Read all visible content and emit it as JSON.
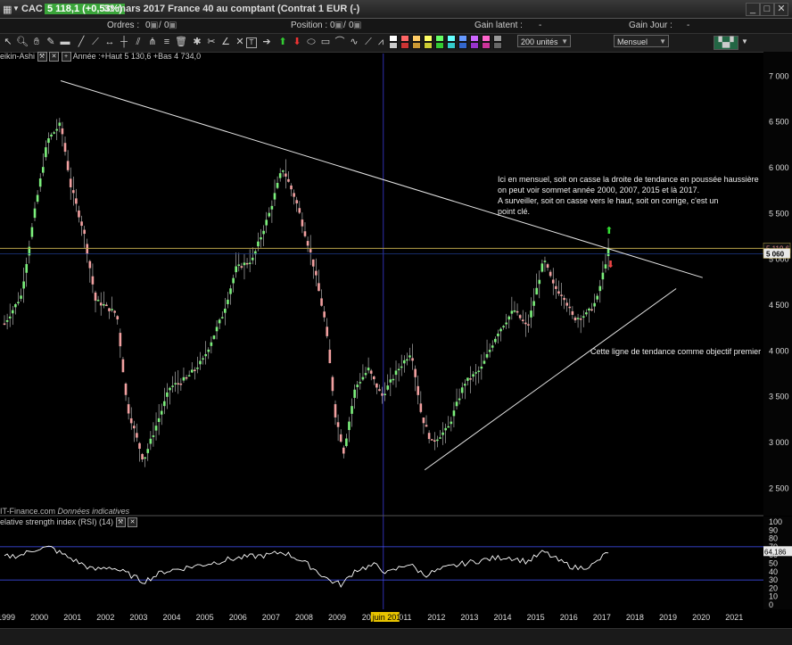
{
  "window": {
    "symbol": "CAC",
    "price_change": "5 118,1 (+0,53%)",
    "description": "31 mars 2017 France 40 au comptant (Contrat 1 EUR (-)"
  },
  "info": {
    "orders_label": "Ordres :",
    "orders_value": "0",
    "orders_value2": "0",
    "position_label": "Position :",
    "position_value": "0",
    "position_value2": "0",
    "gain_latent_label": "Gain latent :",
    "gain_latent_value": "-",
    "gain_jour_label": "Gain Jour :",
    "gain_jour_value": "-"
  },
  "toolbar": {
    "units_select": "200 unités",
    "period_select": "Mensuel"
  },
  "colors": {
    "up_candle": "#7cf07c",
    "down_candle": "#f2a0a0",
    "trend_line": "#e6e6e6",
    "level_line": "#b8a24a",
    "crosshair": "#3a3ad6",
    "rsi_band": "#4455ff",
    "rsi_line": "#ffffff"
  },
  "legend": {
    "name": "eikin-Ashi",
    "values": "Année :+Haut 5 130,6 +Bas 4 734,0"
  },
  "source": {
    "provider": "IT-Finance.com",
    "note": "Données indicatives"
  },
  "rsi_legend": "elative strength index (RSI) (14)",
  "annotations": {
    "top_text": [
      "Ici en mensuel, soit on casse la droite de tendance en poussée haussière",
      "on peut voir sommet année 2000, 2007, 2015 et là 2017.",
      "A surveiller, soit on casse vers le haut, soit on corrige, c'est un",
      "point clé."
    ],
    "bottom_text": "Cette ligne de tendance comme objectif premier"
  },
  "chart_data": {
    "type": "candlestick",
    "variant": "heikin-ashi",
    "timeframe": "monthly",
    "x_axis": {
      "type": "date",
      "tick_labels": [
        "1999",
        "2000",
        "2001",
        "2002",
        "2003",
        "2004",
        "2005",
        "2006",
        "2007",
        "2008",
        "2009",
        "20",
        "juin 2010",
        "2011",
        "2012",
        "2013",
        "2014",
        "2015",
        "2016",
        "2017",
        "2018",
        "2019",
        "2020",
        "2021"
      ],
      "range": [
        1999,
        2021.5
      ]
    },
    "y_axis": {
      "position": "right",
      "ticks": [
        2500,
        3000,
        3500,
        4000,
        4500,
        5000,
        5500,
        6000,
        6500,
        7000
      ],
      "tick_labels": [
        "2 500",
        "3 000",
        "3 500",
        "4 000",
        "4 500",
        "5 000",
        "5 500",
        "6 000",
        "6 500",
        "7 000"
      ],
      "range": [
        2240,
        7130
      ]
    },
    "price_tags": [
      {
        "label": "5 119,6",
        "value": 5119.6
      },
      {
        "label": "5 060",
        "value": 5060
      }
    ],
    "level_lines": [
      5119.6
    ],
    "crosshair_x": 2010.45,
    "trend_lines": [
      {
        "name": "resistance",
        "from": [
          2000.7,
          6950
        ],
        "to": [
          2020.1,
          4800
        ]
      },
      {
        "name": "support",
        "from": [
          2011.7,
          2700
        ],
        "to": [
          2019.3,
          4680
        ]
      }
    ],
    "arrows": [
      {
        "direction": "up",
        "x": 2017.25,
        "y": 5320
      },
      {
        "direction": "down",
        "x": 2017.3,
        "y": 4950
      }
    ],
    "monthly_close_anchors": [
      [
        1999.0,
        4300
      ],
      [
        1999.5,
        4600
      ],
      [
        1999.95,
        5600
      ],
      [
        2000.3,
        6300
      ],
      [
        2000.7,
        6480
      ],
      [
        2001.0,
        5800
      ],
      [
        2001.4,
        5300
      ],
      [
        2001.75,
        4550
      ],
      [
        2002.0,
        4500
      ],
      [
        2002.4,
        4400
      ],
      [
        2002.7,
        3400
      ],
      [
        2003.2,
        2800
      ],
      [
        2003.5,
        3100
      ],
      [
        2004.0,
        3600
      ],
      [
        2004.5,
        3700
      ],
      [
        2005.0,
        3900
      ],
      [
        2005.6,
        4400
      ],
      [
        2006.0,
        4900
      ],
      [
        2006.5,
        5000
      ],
      [
        2007.0,
        5500
      ],
      [
        2007.4,
        6000
      ],
      [
        2007.8,
        5650
      ],
      [
        2008.3,
        5000
      ],
      [
        2008.7,
        4300
      ],
      [
        2009.0,
        3300
      ],
      [
        2009.25,
        2900
      ],
      [
        2009.6,
        3600
      ],
      [
        2010.0,
        3800
      ],
      [
        2010.4,
        3500
      ],
      [
        2010.9,
        3800
      ],
      [
        2011.3,
        4000
      ],
      [
        2011.6,
        3300
      ],
      [
        2011.9,
        3000
      ],
      [
        2012.4,
        3150
      ],
      [
        2012.9,
        3650
      ],
      [
        2013.4,
        3800
      ],
      [
        2013.9,
        4200
      ],
      [
        2014.4,
        4450
      ],
      [
        2014.8,
        4250
      ],
      [
        2015.3,
        5000
      ],
      [
        2015.6,
        4700
      ],
      [
        2015.9,
        4600
      ],
      [
        2016.2,
        4350
      ],
      [
        2016.6,
        4400
      ],
      [
        2016.9,
        4550
      ],
      [
        2017.25,
        5100
      ]
    ],
    "indicator": {
      "name": "RSI",
      "period": 14,
      "y_ticks": [
        0,
        10,
        20,
        30,
        40,
        50,
        60,
        70,
        80,
        90,
        100
      ],
      "bands": [
        30,
        70
      ],
      "last_value_label": "64,186",
      "last_value": 64.186,
      "anchors": [
        [
          1999.0,
          58
        ],
        [
          1999.5,
          60
        ],
        [
          2000.0,
          68
        ],
        [
          2000.4,
          69
        ],
        [
          2000.8,
          60
        ],
        [
          2001.2,
          52
        ],
        [
          2001.7,
          42
        ],
        [
          2002.2,
          46
        ],
        [
          2002.8,
          36
        ],
        [
          2003.2,
          28
        ],
        [
          2003.8,
          40
        ],
        [
          2004.5,
          45
        ],
        [
          2005.2,
          50
        ],
        [
          2005.8,
          55
        ],
        [
          2006.4,
          58
        ],
        [
          2007.0,
          60
        ],
        [
          2007.4,
          64
        ],
        [
          2007.9,
          55
        ],
        [
          2008.3,
          45
        ],
        [
          2008.8,
          30
        ],
        [
          2009.2,
          24
        ],
        [
          2009.6,
          42
        ],
        [
          2010.2,
          48
        ],
        [
          2010.6,
          38
        ],
        [
          2011.2,
          50
        ],
        [
          2011.7,
          36
        ],
        [
          2012.3,
          44
        ],
        [
          2012.9,
          50
        ],
        [
          2013.6,
          55
        ],
        [
          2014.2,
          58
        ],
        [
          2014.8,
          52
        ],
        [
          2015.3,
          64
        ],
        [
          2015.8,
          52
        ],
        [
          2016.3,
          44
        ],
        [
          2016.8,
          48
        ],
        [
          2017.25,
          64.2
        ]
      ]
    }
  }
}
